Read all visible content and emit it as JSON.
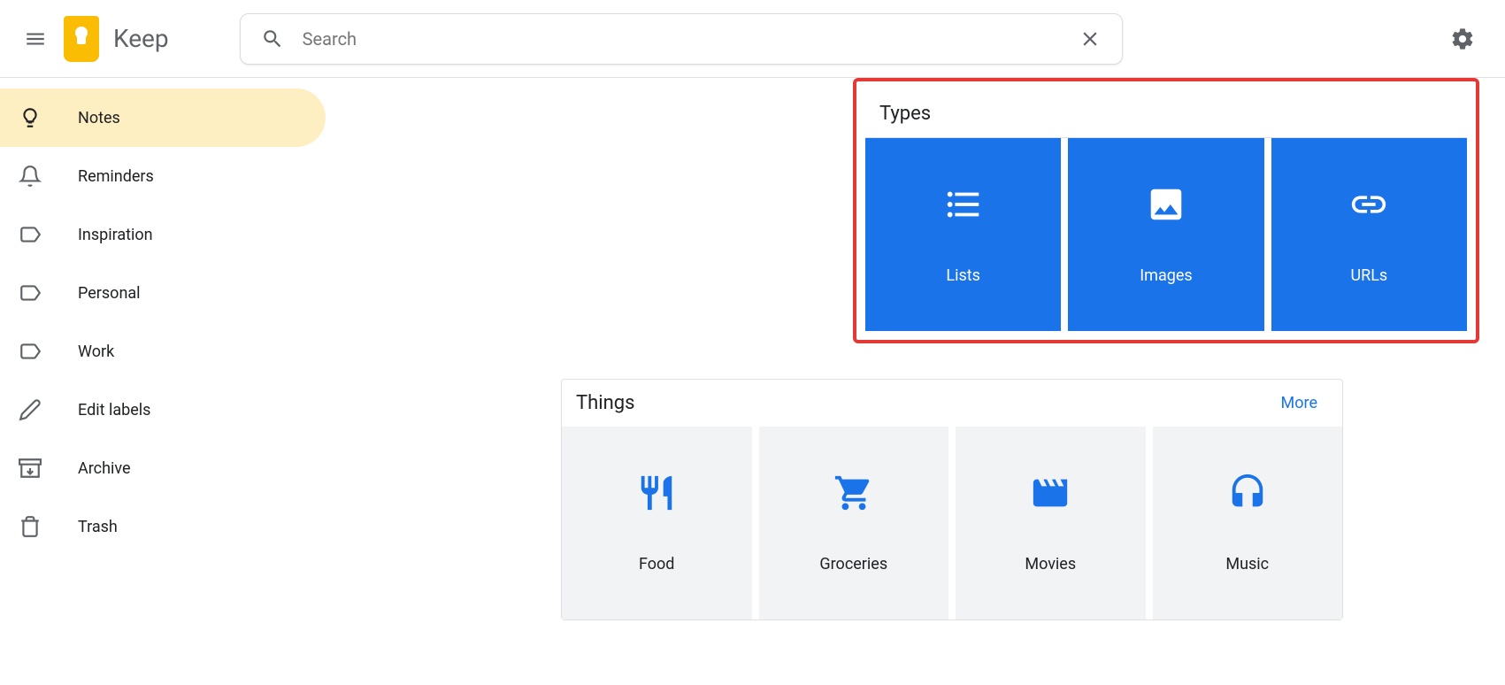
{
  "header": {
    "app_name": "Keep",
    "search_placeholder": "Search"
  },
  "sidebar": {
    "items": [
      {
        "label": "Notes",
        "icon": "lightbulb",
        "active": true
      },
      {
        "label": "Reminders",
        "icon": "bell",
        "active": false
      },
      {
        "label": "Inspiration",
        "icon": "label",
        "active": false
      },
      {
        "label": "Personal",
        "icon": "label",
        "active": false
      },
      {
        "label": "Work",
        "icon": "label",
        "active": false
      },
      {
        "label": "Edit labels",
        "icon": "pencil",
        "active": false
      },
      {
        "label": "Archive",
        "icon": "archive",
        "active": false
      },
      {
        "label": "Trash",
        "icon": "trash",
        "active": false
      }
    ]
  },
  "panels": {
    "types": {
      "title": "Types",
      "tiles": [
        {
          "label": "Lists",
          "icon": "list"
        },
        {
          "label": "Images",
          "icon": "image"
        },
        {
          "label": "URLs",
          "icon": "link"
        }
      ]
    },
    "things": {
      "title": "Things",
      "more_label": "More",
      "tiles": [
        {
          "label": "Food",
          "icon": "food"
        },
        {
          "label": "Groceries",
          "icon": "cart"
        },
        {
          "label": "Movies",
          "icon": "film"
        },
        {
          "label": "Music",
          "icon": "headphones"
        }
      ]
    }
  }
}
